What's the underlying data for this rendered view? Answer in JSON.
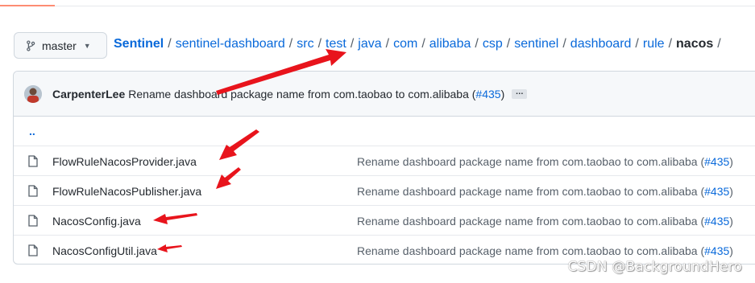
{
  "branch": {
    "label": "master",
    "icon": "git-branch-icon"
  },
  "breadcrumb": {
    "repo": "Sentinel",
    "separator": "/",
    "path": [
      "sentinel-dashboard",
      "src",
      "test",
      "java",
      "com",
      "alibaba",
      "csp",
      "sentinel",
      "dashboard",
      "rule"
    ],
    "current": "nacos",
    "trailing": "/"
  },
  "commit": {
    "author": "CarpenterLee",
    "message": "Rename dashboard package name from com.taobao to com.alibaba (",
    "pr": "#435",
    "close": ")",
    "ellipsis": "…"
  },
  "updir": "..",
  "files": [
    {
      "name": "FlowRuleNacosProvider.java",
      "message": "Rename dashboard package name from com.taobao to com.alibaba (",
      "pr": "#435",
      "close": ")",
      "icon": "file-icon"
    },
    {
      "name": "FlowRuleNacosPublisher.java",
      "message": "Rename dashboard package name from com.taobao to com.alibaba (",
      "pr": "#435",
      "close": ")",
      "icon": "file-icon"
    },
    {
      "name": "NacosConfig.java",
      "message": "Rename dashboard package name from com.taobao to com.alibaba (",
      "pr": "#435",
      "close": ")",
      "icon": "file-icon"
    },
    {
      "name": "NacosConfigUtil.java",
      "message": "Rename dashboard package name from com.taobao to com.alibaba (",
      "pr": "#435",
      "close": ")",
      "icon": "file-icon"
    }
  ],
  "watermark": "CSDN @BackgroundHero",
  "colors": {
    "link": "#0969da",
    "annotation_arrow": "#e8141c",
    "tab_underline": "#fd8c73"
  }
}
